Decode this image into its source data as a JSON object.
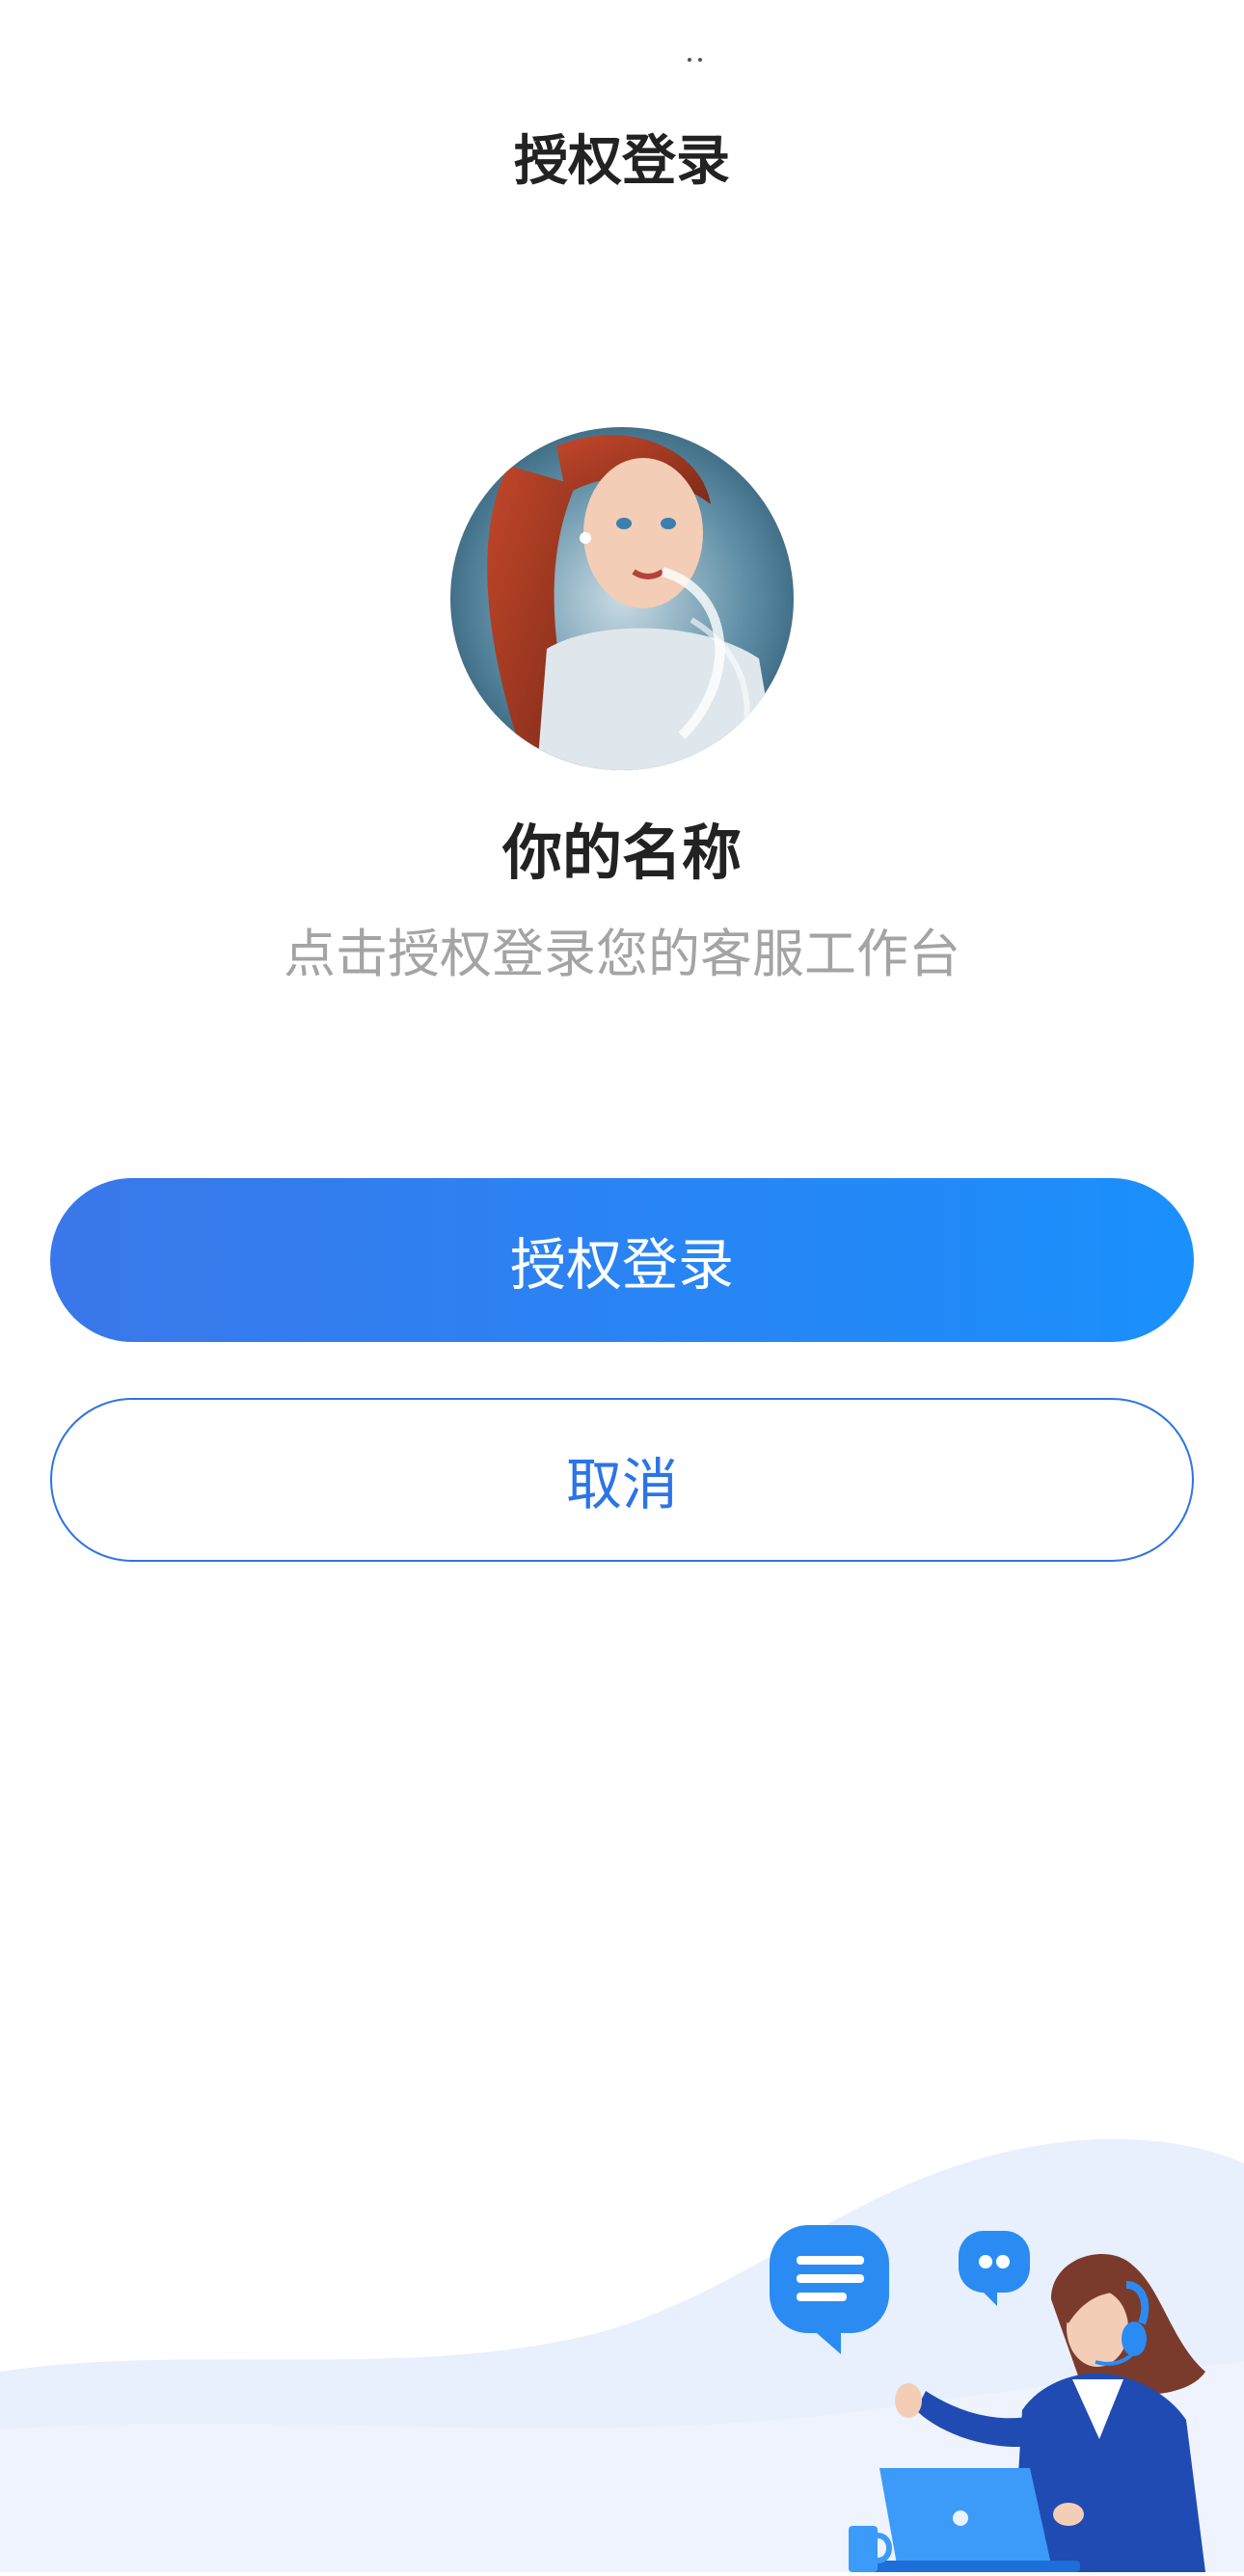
{
  "header": {
    "title": "授权登录"
  },
  "profile": {
    "name": "你的名称",
    "description": "点击授权登录您的客服工作台"
  },
  "actions": {
    "authorize_label": "授权登录",
    "cancel_label": "取消"
  },
  "colors": {
    "primary_gradient_start": "#3a77ea",
    "primary_gradient_end": "#1a90fc",
    "accent": "#2d74e6",
    "muted_text": "#a4a4a4",
    "title_text": "#222222"
  }
}
